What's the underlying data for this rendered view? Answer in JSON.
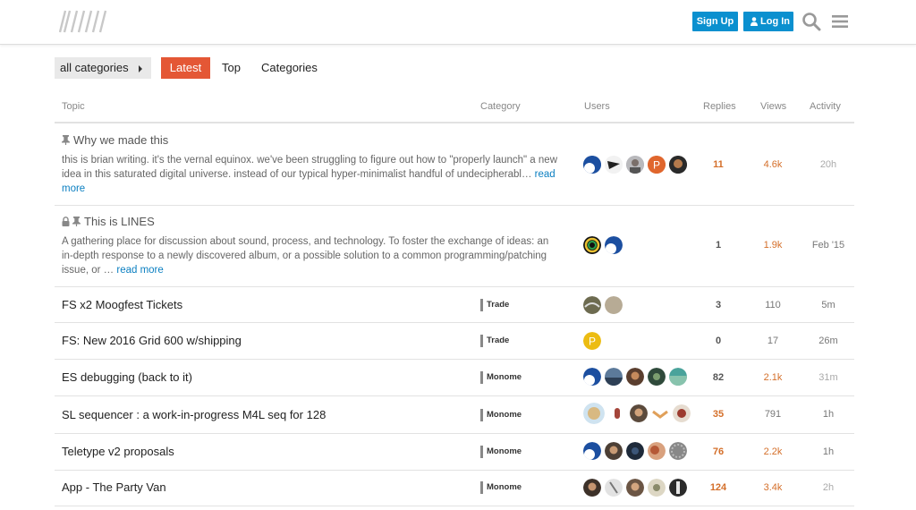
{
  "header": {
    "signup_label": "Sign Up",
    "login_label": "Log In"
  },
  "nav": {
    "category_dropdown": "all categories",
    "tabs": [
      "Latest",
      "Top",
      "Categories"
    ],
    "active_tab": "Latest"
  },
  "columns": {
    "topic": "Topic",
    "category": "Category",
    "users": "Users",
    "replies": "Replies",
    "views": "Views",
    "activity": "Activity"
  },
  "colors": {
    "accent": "#e45735",
    "brand_blue": "#0b90cf",
    "link": "#0b7fc1",
    "hot_number": "#d46f2a"
  },
  "topics": [
    {
      "title": "Why we made this",
      "pinned": true,
      "excerpt": "this is brian writing. it's the vernal equinox. we've been struggling to figure out how to \"properly launch\" a new idea in this saturated digital universe. instead of our typical hyper-minimalist handful of undecipherabl…",
      "read_more": "read more",
      "replies": "11",
      "views": "4.6k",
      "activity": "20h"
    },
    {
      "title": "This is LINES",
      "pinned": true,
      "locked": true,
      "excerpt": "A gathering place for discussion about sound, process, and technology. To foster the exchange of ideas: an in-depth response to a newly discovered album, or a possible solution to a common programming/patching issue, or …",
      "read_more": "read more",
      "replies": "1",
      "views": "1.9k",
      "activity": "Feb '15"
    },
    {
      "title": "FS x2 Moogfest Tickets",
      "category": "Trade",
      "replies": "3",
      "views": "110",
      "activity": "5m"
    },
    {
      "title": "FS: New 2016 Grid 600 w/shipping",
      "category": "Trade",
      "replies": "0",
      "views": "17",
      "activity": "26m"
    },
    {
      "title": "ES debugging (back to it)",
      "category": "Monome",
      "replies": "82",
      "views": "2.1k",
      "activity": "31m"
    },
    {
      "title": "SL sequencer : a work-in-progress M4L seq for 128",
      "category": "Monome",
      "replies": "35",
      "views": "791",
      "activity": "1h"
    },
    {
      "title": "Teletype v2 proposals",
      "category": "Monome",
      "replies": "76",
      "views": "2.2k",
      "activity": "1h"
    },
    {
      "title": "App - The Party Van",
      "category": "Monome",
      "replies": "124",
      "views": "3.4k",
      "activity": "2h"
    }
  ]
}
